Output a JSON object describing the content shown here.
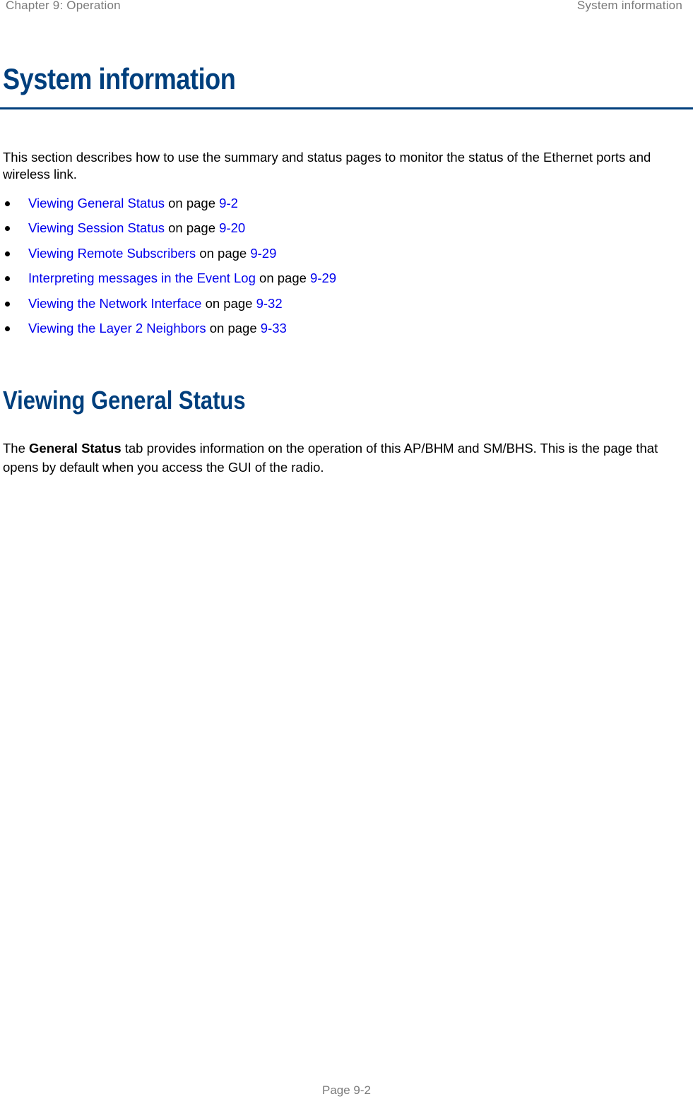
{
  "header": {
    "chapter": "Chapter 9:  Operation",
    "section": "System information"
  },
  "section": {
    "title": "System information",
    "intro": "This section describes how to use the summary and status pages to monitor the status of the Ethernet ports and wireless link.",
    "toc": [
      {
        "link_text": "Viewing General Status",
        "connector": " on page ",
        "page_ref": "9-2"
      },
      {
        "link_text": "Viewing Session Status",
        "connector": " on page ",
        "page_ref": "9-20"
      },
      {
        "link_text": "Viewing Remote Subscribers",
        "connector": " on page ",
        "page_ref": "9-29"
      },
      {
        "link_text": "Interpreting messages in the Event Log",
        "connector": " on page ",
        "page_ref": "9-29"
      },
      {
        "link_text": "Viewing the Network Interface",
        "connector": " on page ",
        "page_ref": "9-32"
      },
      {
        "link_text": "Viewing the Layer 2 Neighbors",
        "connector": " on page ",
        "page_ref": "9-33"
      }
    ]
  },
  "subsection": {
    "title": "Viewing General Status",
    "para_prefix": "The ",
    "para_bold": "General Status",
    "para_suffix": " tab provides information on the operation of this AP/BHM and SM/BHS. This is the page that opens by default when you access the GUI of the radio."
  },
  "footer": {
    "page_label": "Page 9-2"
  },
  "colors": {
    "heading": "#003f7d",
    "link": "#0000ee",
    "running_text": "#7a7a7a"
  }
}
